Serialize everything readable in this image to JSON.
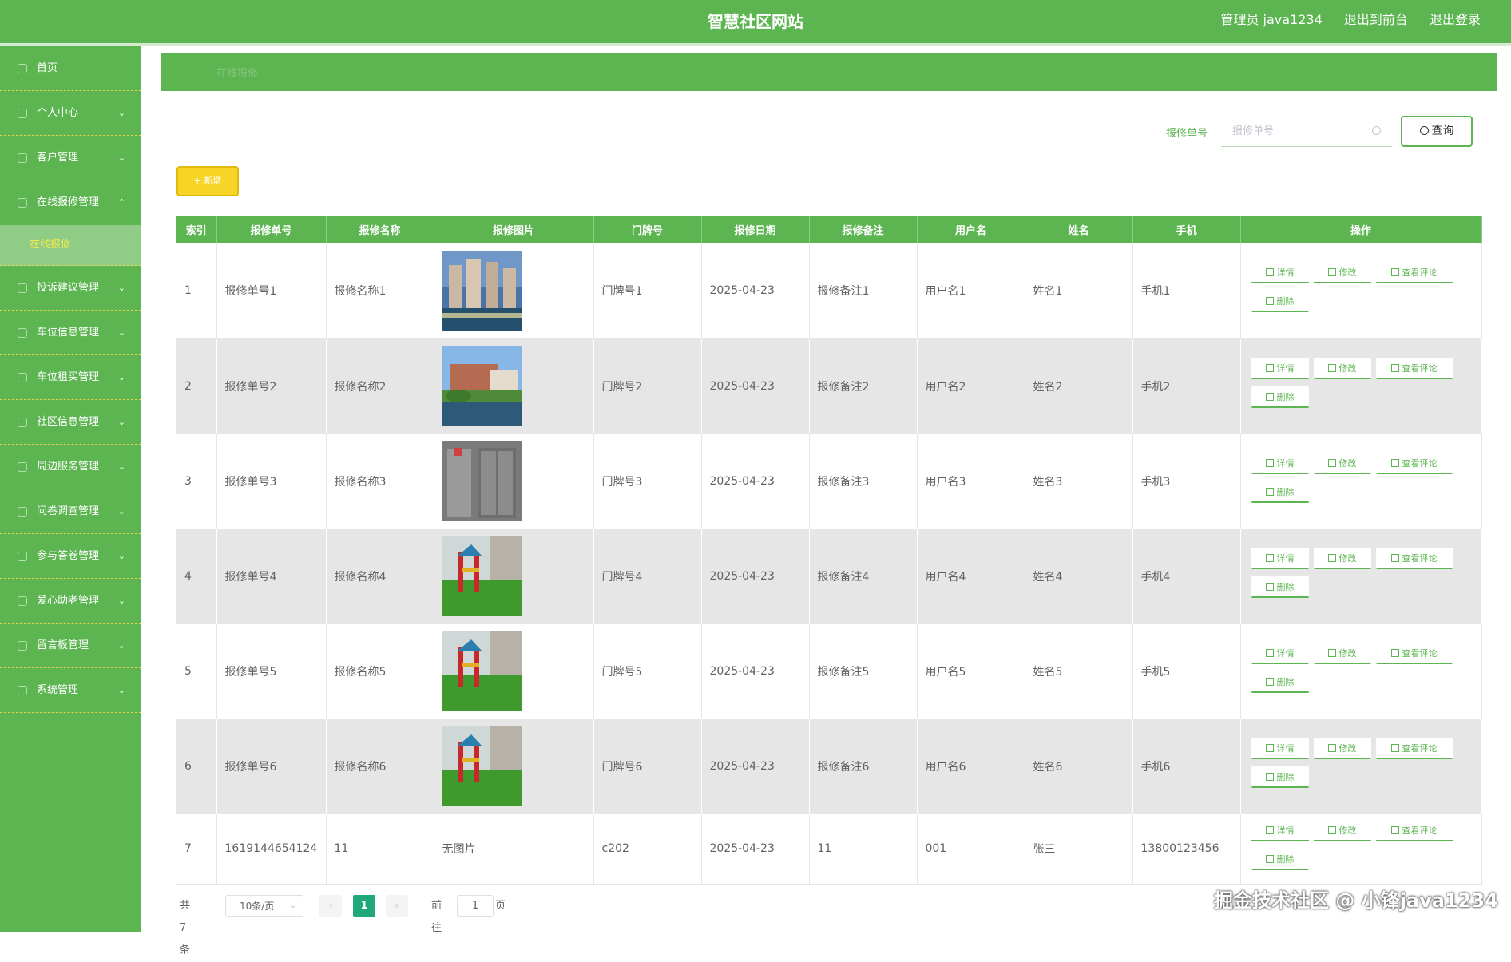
{
  "header": {
    "title": "智慧社区网站",
    "user": "管理员 java1234",
    "to_front": "退出到前台",
    "logout": "退出登录"
  },
  "sidebar": {
    "items": [
      {
        "label": "首页",
        "arrow": ""
      },
      {
        "label": "个人中心",
        "arrow": "⌄"
      },
      {
        "label": "客户管理",
        "arrow": "⌄"
      },
      {
        "label": "在线报修管理",
        "arrow": "⌃"
      },
      {
        "label": "投诉建议管理",
        "arrow": "⌄"
      },
      {
        "label": "车位信息管理",
        "arrow": "⌄"
      },
      {
        "label": "车位租买管理",
        "arrow": "⌄"
      },
      {
        "label": "社区信息管理",
        "arrow": "⌄"
      },
      {
        "label": "周边服务管理",
        "arrow": "⌄"
      },
      {
        "label": "问卷调查管理",
        "arrow": "⌄"
      },
      {
        "label": "参与答卷管理",
        "arrow": "⌄"
      },
      {
        "label": "爱心助老管理",
        "arrow": "⌄"
      },
      {
        "label": "留言板管理",
        "arrow": "⌄"
      },
      {
        "label": "系统管理",
        "arrow": "⌄"
      }
    ],
    "submenu_active": "在线报修"
  },
  "breadcrumb": "在线报修",
  "search": {
    "label": "报修单号",
    "placeholder": "报修单号",
    "button": "查询"
  },
  "add_button": "+ 新增",
  "table": {
    "columns": [
      "索引",
      "报修单号",
      "报修名称",
      "报修图片",
      "门牌号",
      "报修日期",
      "报修备注",
      "用户名",
      "姓名",
      "手机",
      "操作"
    ],
    "rows": [
      {
        "index": "1",
        "no": "报修单号1",
        "name": "报修名称1",
        "img": "building",
        "img_text": "",
        "door": "门牌号1",
        "date": "2025-04-23",
        "remark": "报修备注1",
        "username": "用户名1",
        "realname": "姓名1",
        "phone": "手机1"
      },
      {
        "index": "2",
        "no": "报修单号2",
        "name": "报修名称2",
        "img": "villa",
        "img_text": "",
        "door": "门牌号2",
        "date": "2025-04-23",
        "remark": "报修备注2",
        "username": "用户名2",
        "realname": "姓名2",
        "phone": "手机2"
      },
      {
        "index": "3",
        "no": "报修单号3",
        "name": "报修名称3",
        "img": "elevator",
        "img_text": "",
        "door": "门牌号3",
        "date": "2025-04-23",
        "remark": "报修备注3",
        "username": "用户名3",
        "realname": "姓名3",
        "phone": "手机3"
      },
      {
        "index": "4",
        "no": "报修单号4",
        "name": "报修名称4",
        "img": "playground",
        "img_text": "",
        "door": "门牌号4",
        "date": "2025-04-23",
        "remark": "报修备注4",
        "username": "用户名4",
        "realname": "姓名4",
        "phone": "手机4"
      },
      {
        "index": "5",
        "no": "报修单号5",
        "name": "报修名称5",
        "img": "playground",
        "img_text": "",
        "door": "门牌号5",
        "date": "2025-04-23",
        "remark": "报修备注5",
        "username": "用户名5",
        "realname": "姓名5",
        "phone": "手机5"
      },
      {
        "index": "6",
        "no": "报修单号6",
        "name": "报修名称6",
        "img": "playground",
        "img_text": "",
        "door": "门牌号6",
        "date": "2025-04-23",
        "remark": "报修备注6",
        "username": "用户名6",
        "realname": "姓名6",
        "phone": "手机6"
      },
      {
        "index": "7",
        "no": "1619144654124",
        "name": "11",
        "img": "",
        "img_text": "无图片",
        "door": "c202",
        "date": "2025-04-23",
        "remark": "11",
        "username": "001",
        "realname": "张三",
        "phone": "13800123456"
      }
    ],
    "actions": {
      "detail": "详情",
      "edit": "修改",
      "comment": "查看评论",
      "delete": "删除"
    }
  },
  "pagination": {
    "total": "共 7 条",
    "page_size": "10条/页",
    "current_page": "1",
    "goto_label": "前往",
    "goto_value": "1",
    "page_unit": "页"
  },
  "watermark": "掘金技术社区 @ 小锋java1234",
  "colors": {
    "primary": "#5cb551",
    "add_button": "#f6d526",
    "active_page": "#21a77c",
    "submenu_active_text": "#f1e84a"
  }
}
